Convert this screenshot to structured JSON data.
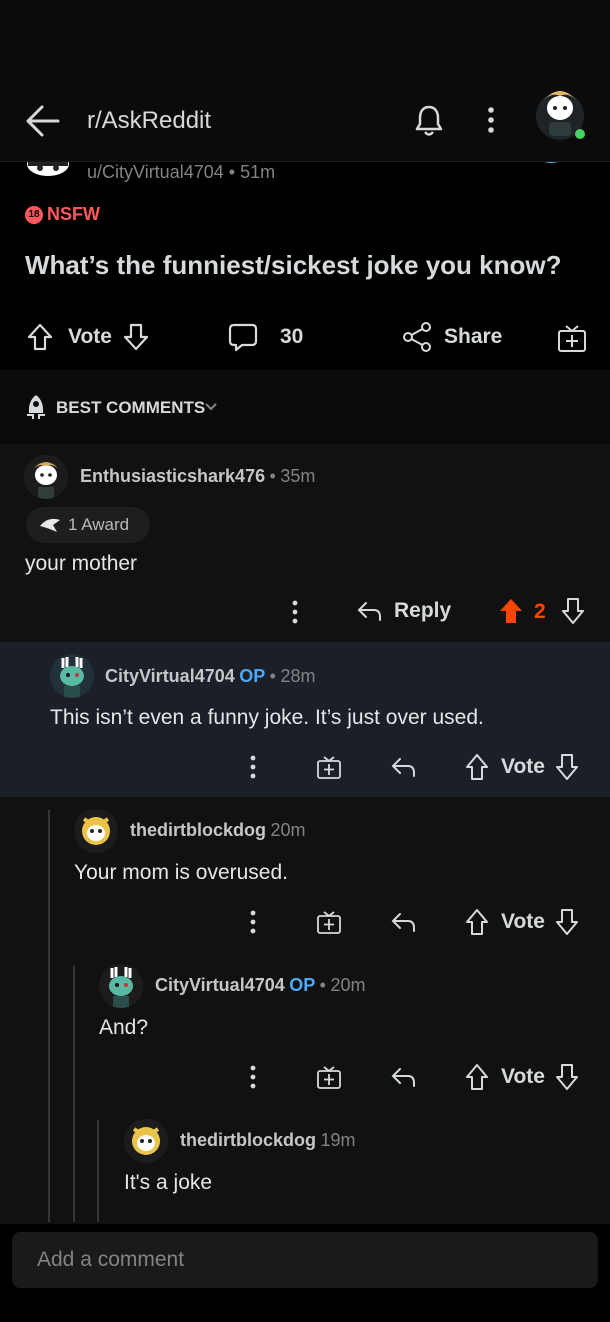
{
  "header": {
    "title": "r/AskReddit"
  },
  "post": {
    "author": "u/CityVirtual4704",
    "sep": "•",
    "age": "51m",
    "nsfw_badge": "NSFW",
    "nsfw_age": "18",
    "title": "What’s the funniest/sickest joke you know?",
    "vote_label": "Vote",
    "comment_count": "30",
    "share_label": "Share"
  },
  "sort": {
    "label": "BEST COMMENTS"
  },
  "comments": [
    {
      "user": "Enthusiasticshark476",
      "sep": "•",
      "age": "35m",
      "award": "1 Award",
      "body": "your mother",
      "reply_label": "Reply",
      "score": "2"
    },
    {
      "user": "CityVirtual4704",
      "op": "OP",
      "sep": "•",
      "age": "28m",
      "body": "This isn’t even a funny joke. It’s just over used.",
      "vote_label": "Vote"
    },
    {
      "user": "thedirtblockdog",
      "age": "20m",
      "body": "Your mom is overused.",
      "vote_label": "Vote"
    },
    {
      "user": "CityVirtual4704",
      "op": "OP",
      "sep": "•",
      "age": "20m",
      "body": "And?",
      "vote_label": "Vote"
    },
    {
      "user": "thedirtblockdog",
      "age": "19m",
      "body": "It's a joke"
    }
  ],
  "composer": {
    "placeholder": "Add a comment"
  },
  "colors": {
    "upvote": "#ff4500",
    "op": "#4fa8f5",
    "online": "#46d160",
    "nsfw": "#ff585b"
  }
}
